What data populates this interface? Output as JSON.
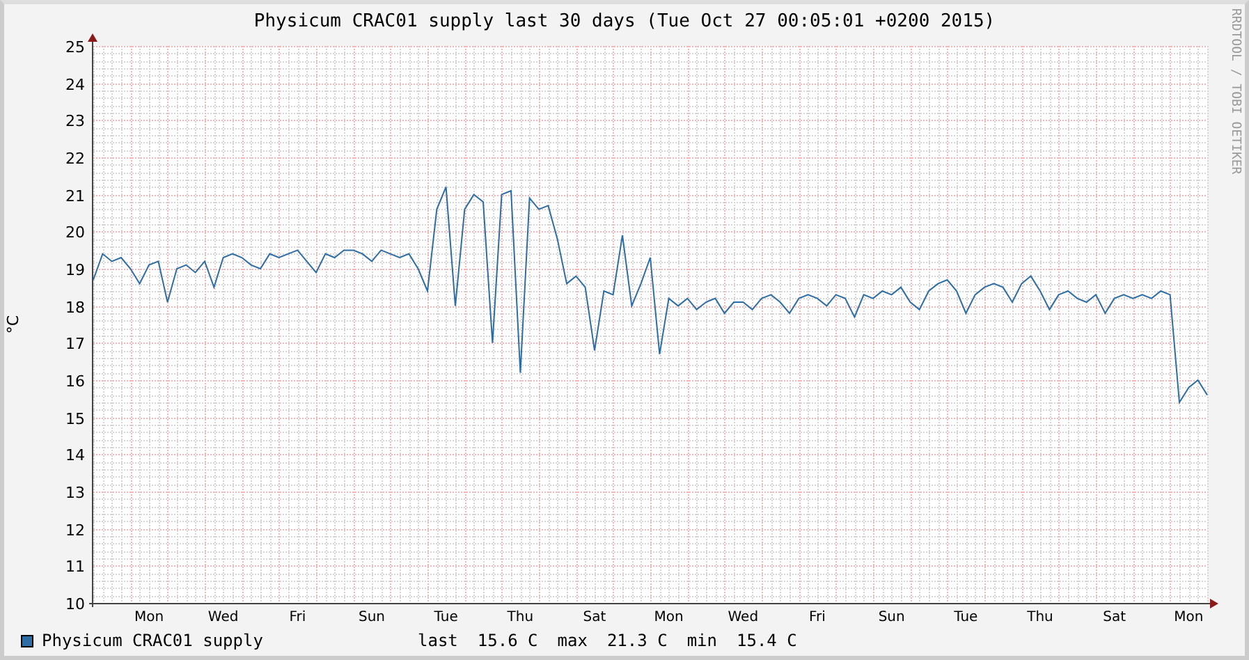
{
  "title": "Physicum CRAC01 supply last 30 days (Tue Oct 27 00:05:01 +0200 2015)",
  "credit": "RRDTOOL / TOBI OETIKER",
  "chart_data": {
    "type": "line",
    "ylabel": "°C",
    "grid": true,
    "ylim": [
      10,
      25
    ],
    "categories": [
      null,
      null,
      null,
      null,
      null,
      null,
      "Mon",
      null,
      null,
      null,
      null,
      null,
      null,
      null,
      "Wed",
      null,
      null,
      null,
      null,
      null,
      null,
      null,
      "Fri",
      null,
      null,
      null,
      null,
      null,
      null,
      null,
      "Sun",
      null,
      null,
      null,
      null,
      null,
      null,
      null,
      "Tue",
      null,
      null,
      null,
      null,
      null,
      null,
      null,
      "Thu",
      null,
      null,
      null,
      null,
      null,
      null,
      null,
      "Sat",
      null,
      null,
      null,
      null,
      null,
      null,
      null,
      "Mon",
      null,
      null,
      null,
      null,
      null,
      null,
      null,
      "Wed",
      null,
      null,
      null,
      null,
      null,
      null,
      null,
      "Fri",
      null,
      null,
      null,
      null,
      null,
      null,
      null,
      "Sun",
      null,
      null,
      null,
      null,
      null,
      null,
      null,
      "Tue",
      null,
      null,
      null,
      null,
      null,
      null,
      null,
      "Thu",
      null,
      null,
      null,
      null,
      null,
      null,
      null,
      "Sat",
      null,
      null,
      null,
      null,
      null,
      null,
      null,
      "Mon",
      null,
      null
    ],
    "yticks": [
      10,
      11,
      12,
      13,
      14,
      15,
      16,
      17,
      18,
      19,
      20,
      21,
      22,
      23,
      24,
      25
    ],
    "series": [
      {
        "name": "Physicum CRAC01 supply",
        "color": "#2e6da4",
        "values": [
          18.7,
          19.4,
          19.2,
          19.3,
          19.0,
          18.6,
          19.1,
          19.2,
          18.1,
          19.0,
          19.1,
          18.9,
          19.2,
          18.5,
          19.3,
          19.4,
          19.3,
          19.1,
          19.0,
          19.4,
          19.3,
          19.4,
          19.5,
          19.2,
          18.9,
          19.4,
          19.3,
          19.5,
          19.5,
          19.4,
          19.2,
          19.5,
          19.4,
          19.3,
          19.4,
          19.0,
          18.4,
          20.6,
          21.2,
          18.0,
          20.6,
          21.0,
          20.8,
          17.0,
          21.0,
          21.1,
          16.2,
          20.9,
          20.6,
          20.7,
          19.8,
          18.6,
          18.8,
          18.5,
          16.8,
          18.4,
          18.3,
          19.9,
          18.0,
          18.6,
          19.3,
          16.7,
          18.2,
          18.0,
          18.2,
          17.9,
          18.1,
          18.2,
          17.8,
          18.1,
          18.1,
          17.9,
          18.2,
          18.3,
          18.1,
          17.8,
          18.2,
          18.3,
          18.2,
          18.0,
          18.3,
          18.2,
          17.7,
          18.3,
          18.2,
          18.4,
          18.3,
          18.5,
          18.1,
          17.9,
          18.4,
          18.6,
          18.7,
          18.4,
          17.8,
          18.3,
          18.5,
          18.6,
          18.5,
          18.1,
          18.6,
          18.8,
          18.4,
          17.9,
          18.3,
          18.4,
          18.2,
          18.1,
          18.3,
          17.8,
          18.2,
          18.3,
          18.2,
          18.3,
          18.2,
          18.4,
          18.3,
          15.4,
          15.8,
          16.0,
          15.6
        ]
      }
    ]
  },
  "legend": {
    "stats": [
      {
        "label": "last",
        "value": "15.6 C"
      },
      {
        "label": "max",
        "value": "21.3 C"
      },
      {
        "label": "min",
        "value": "15.4 C"
      }
    ]
  }
}
